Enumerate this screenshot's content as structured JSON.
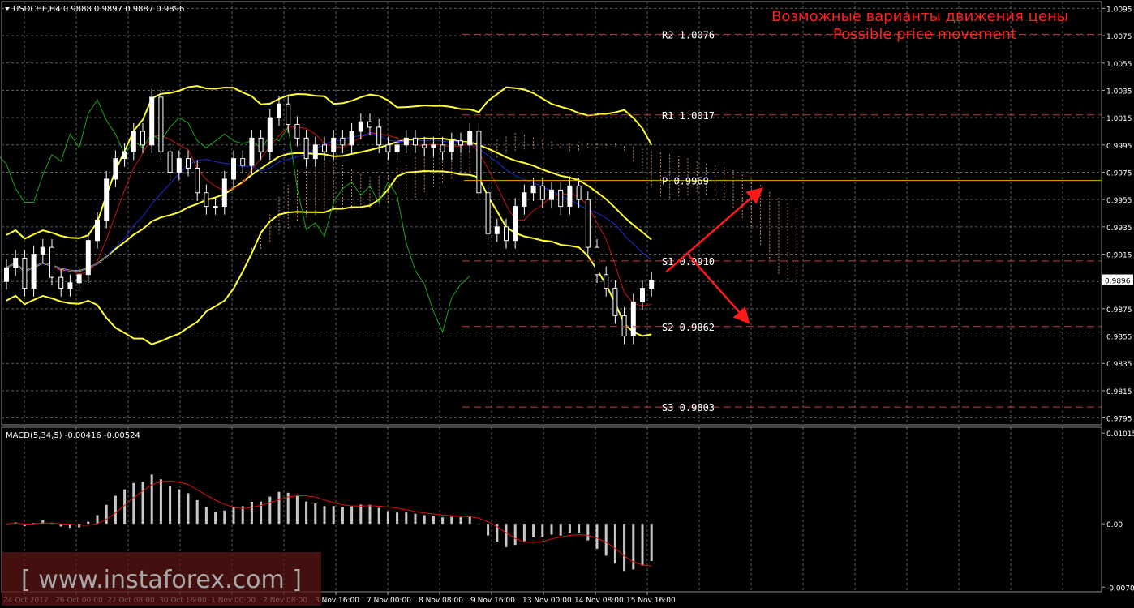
{
  "header": {
    "symbol_line": "USDCHF,H4  0.9888 0.9897 0.9887 0.9896",
    "title_ru": "Возможные варианты движения цены",
    "title_en": "Possible price movement"
  },
  "watermark": "[ www.instaforex.com ]",
  "colors": {
    "background": "#000000",
    "grid": "#5a5a5a",
    "bull_candle": "#ffffff",
    "bear_candle": "#000000",
    "bollinger": "#ffff33",
    "tenkan": "#cc1111",
    "kijun": "#1a2ad8",
    "chikou": "#19a319",
    "cloud": "#e8a27a",
    "levels": "#c23a3a",
    "pivot": "#e8a600",
    "arrows": "#ff1a1a",
    "macd_hist": "#c8c8c8",
    "macd_signal": "#dd1111",
    "title": "#ff2020"
  },
  "chart_data": {
    "type": "candlestick",
    "symbol": "USDCHF",
    "timeframe": "H4",
    "ohlc_last": {
      "open": 0.9888,
      "high": 0.9897,
      "low": 0.9887,
      "close": 0.9896
    },
    "current_price": "0.9896",
    "price_axis": {
      "ticks": [
        "1.0095",
        "1.0075",
        "1.0055",
        "1.0035",
        "1.0015",
        "0.9995",
        "0.9975",
        "0.9955",
        "0.9935",
        "0.9915",
        "0.9895",
        "0.9875",
        "0.9855",
        "0.9835",
        "0.9815",
        "0.9795"
      ],
      "range": [
        0.979,
        1.01
      ]
    },
    "time_axis": {
      "ticks": [
        "24 Oct 2017",
        "26 Oct 00:00",
        "27 Oct 08:00",
        "30 Oct 16:00",
        "1 Nov 00:00",
        "2 Nov 08:00",
        "3 Nov 16:00",
        "7 Nov 00:00",
        "8 Nov 08:00",
        "9 Nov 16:00",
        "13 Nov 00:00",
        "14 Nov 08:00",
        "15 Nov 16:00"
      ]
    },
    "levels": [
      {
        "label": "R2",
        "value": "1.0076"
      },
      {
        "label": "R1",
        "value": "1.0017"
      },
      {
        "label": "P",
        "value": "0.9969"
      },
      {
        "label": "S1",
        "value": "0.9910"
      },
      {
        "label": "S2",
        "value": "0.9862"
      },
      {
        "label": "S3",
        "value": "0.9803"
      }
    ],
    "closes": [
      0.9905,
      0.9912,
      0.989,
      0.9915,
      0.992,
      0.9898,
      0.989,
      0.9894,
      0.99,
      0.9925,
      0.994,
      0.997,
      0.9985,
      0.999,
      1.0005,
      0.9995,
      1.003,
      0.999,
      0.9975,
      0.9985,
      0.9978,
      0.996,
      0.995,
      0.995,
      0.997,
      0.9985,
      0.998,
      1.0,
      0.999,
      1.0015,
      1.0025,
      1.001,
      1.0,
      0.9985,
      0.9995,
      0.999,
      1.0,
      0.9995,
      1.0005,
      1.0012,
      1.0008,
      0.9995,
      0.999,
      0.9995,
      1.0,
      0.9995,
      0.9993,
      0.9995,
      0.999,
      0.9998,
      0.9995,
      1.0005,
      0.996,
      0.993,
      0.9935,
      0.9925,
      0.995,
      0.996,
      0.9965,
      0.9955,
      0.9962,
      0.995,
      0.9965,
      0.9955,
      0.992,
      0.99,
      0.989,
      0.987,
      0.9855,
      0.988,
      0.989,
      0.9896
    ],
    "macd": {
      "label": "MACD(5,34,5) -0.00416 -0.00524",
      "params": [
        5,
        34,
        5
      ],
      "value": -0.00416,
      "signal_value": -0.00524,
      "axis_ticks": [
        "0.01015",
        "0.00",
        "-0.00708"
      ],
      "range": [
        -0.0076,
        0.0108
      ]
    },
    "forecast_arrows": [
      "up from S1 toward P",
      "down from S1 toward S2"
    ]
  }
}
